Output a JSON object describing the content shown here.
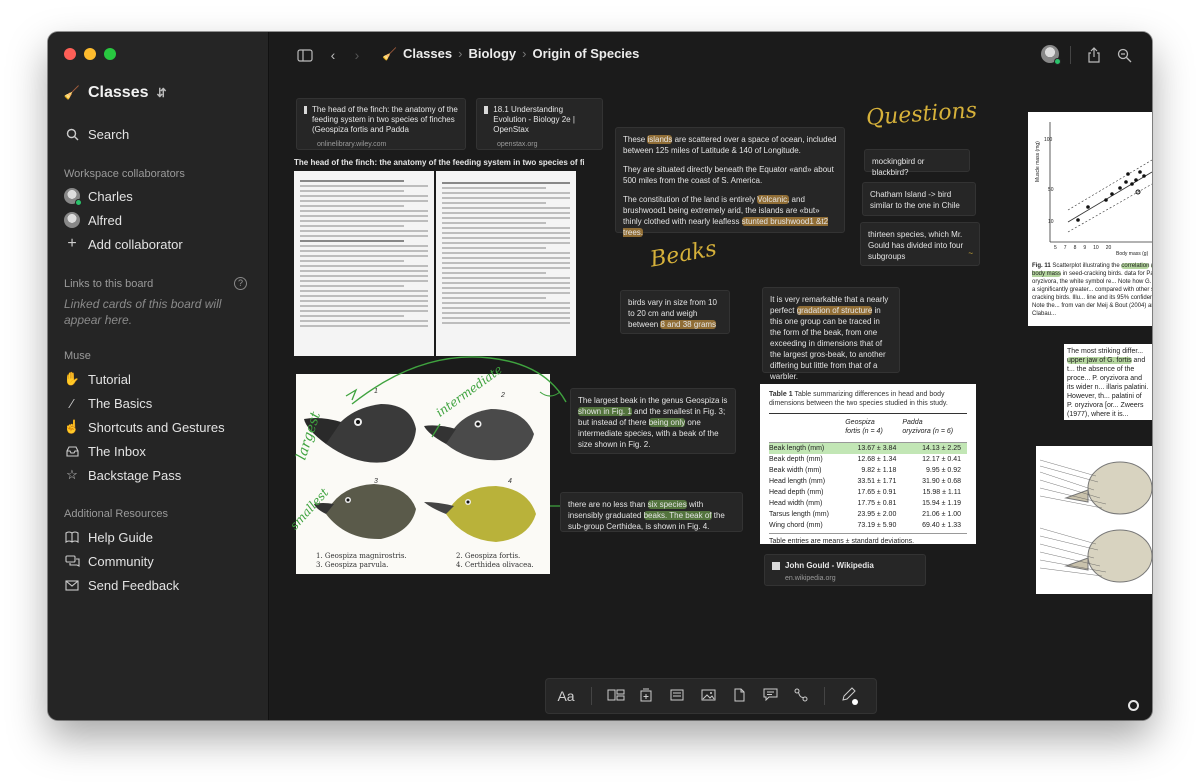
{
  "sidebar": {
    "board_title": "Classes",
    "search_label": "Search",
    "collaborators_header": "Workspace collaborators",
    "collaborators": [
      "Charles",
      "Alfred"
    ],
    "add_collaborator": "Add collaborator",
    "links_header": "Links to this board",
    "links_note": "Linked cards of this board will appear here.",
    "muse_header": "Muse",
    "muse_items": [
      "Tutorial",
      "The Basics",
      "Shortcuts and Gestures",
      "The Inbox",
      "Backstage Pass"
    ],
    "resources_header": "Additional Resources",
    "resource_items": [
      "Help Guide",
      "Community",
      "Send Feedback"
    ]
  },
  "breadcrumb": [
    "Classes",
    "Biology",
    "Origin of Species"
  ],
  "cards": {
    "link1_title": "The head of the finch: the anatomy of the feeding system in two species of finches (Geospiza fortis and Padda",
    "link1_url": "onlinelibrary.wiley.com",
    "link2_title": "18.1 Understanding Evolution - Biology 2e | OpenStax",
    "link2_url": "openstax.org",
    "pdf_title": "The head of the finch: the anatomy of the feeding system in two species of finches (Ge...",
    "islands_p1_a": "These ",
    "islands_p1_hl": "islands",
    "islands_p1_b": " are scattered over a space of ocean, included between 125 miles of Latitude & 140 of Longitude.",
    "islands_p2": "They are situated directly beneath the Equator «and» about 500 miles from the coast of S. America.",
    "islands_p3_a": "The constitution of the land is entirely ",
    "islands_p3_hl": "Volcanic,",
    "islands_p3_b": " and brushwood1 being extremely arid, the islands are «but» thinly clothed with nearly leafless ",
    "islands_p3_hl2": "stunted brushwood1 &t2 trees.",
    "questions_title": "Questions",
    "q1": "mockingbird or blackbird?",
    "q2": "Chatham Island -> bird similar to the one in Chile",
    "q3": "thirteen species, which Mr. Gould has divided into four subgroups",
    "beaks_title": "Beaks",
    "beaks_size_a": "birds vary in size from 10 to 20 cm and weigh between ",
    "beaks_size_hl": "8 and 38 grams",
    "gradation_a": "It is very remarkable that a nearly perfect ",
    "gradation_hl": "gradation of structure",
    "gradation_b": " in this one group can be traced in the form of the beak, from one exceeding in dimensions that of the largest gros-beak, to another differing but little from that of a warbler.",
    "largest_a": "The largest beak in the genus Geospiza is ",
    "largest_hl": "shown in Fig. 1",
    "largest_b": " and the smallest in Fig. 3; but instead of there ",
    "largest_hl2": "being only",
    "largest_c": " one intermediate species, with a beak of the size shown in Fig. 2.",
    "six_a": "there are no less than ",
    "six_hl": "six species",
    "six_b": " with insensibly graduated ",
    "six_hl2": "beaks. The beak of",
    "six_c": " the sub-group Certhidea, is shown in Fig. 4.",
    "gould_title": "John Gould - Wikipedia",
    "gould_url": "en.wikipedia.org",
    "fig11_caption_a": "Fig. 11",
    "fig11_caption_b": " Scatterplot illustrating the ",
    "fig11_caption_hl": "correlation",
    "fig11_caption_hl2": "mass and body mass",
    "fig11_caption_c": " in seed-cracking birds. data for Padda oryzivora, the white symbol re... Note how G. fortis has a significantly greater... compared with other seed-cracking birds. Illu... line and its 95% confidence limits. Note the... from van der Meij & Bout (2004) and Clabau...",
    "fig11_xlabel": "Body mass (g)",
    "fig11_ylabel": "Muscle mass (mg)",
    "fig11_xticks": [
      "5",
      "7",
      "8",
      "9",
      "10",
      "20"
    ],
    "fig11_yticks": [
      "100",
      "50",
      "10"
    ],
    "excerpt_a": "The most striking differ... ",
    "excerpt_hl": "upper jaw of G. fortis",
    "excerpt_b": " and t... the absence of the proce... P. oryzivora and its wider n... illaris palatini. However, th... palatini of P. oryzivora [or... Zweers (1977), where it is... probably results from a fusi..."
  },
  "annotations": {
    "largest": "largest",
    "intermediate": "intermediate",
    "smallest": "smallest"
  },
  "illustration_captions": [
    "1. Geospiza magnirostris.",
    "2. Geospiza fortis.",
    "3. Geospiza parvula.",
    "4. Certhidea olivacea."
  ],
  "illustration_numbers": [
    "1",
    "2",
    "3",
    "4"
  ],
  "table": {
    "caption_label": "Table 1",
    "caption": "Table summarizing differences in head and body dimensions between the two species studied in this study.",
    "col1": "Geospiza",
    "col1_n": "fortis (n = 4)",
    "col2": "Padda",
    "col2_n": "oryzivora (n = 6)",
    "rows": [
      [
        "Beak length (mm)",
        "13.67 ± 3.84",
        "14.13 ± 2.25"
      ],
      [
        "Beak depth (mm)",
        "12.68 ± 1.34",
        "12.17 ± 0.41"
      ],
      [
        "Beak width (mm)",
        "9.82 ± 1.18",
        "9.95 ± 0.92"
      ],
      [
        "Head length (mm)",
        "33.51 ± 1.71",
        "31.90 ± 0.68"
      ],
      [
        "Head depth (mm)",
        "17.65 ± 0.91",
        "15.98 ± 1.11"
      ],
      [
        "Head width (mm)",
        "17.75 ± 0.81",
        "15.94 ± 1.19"
      ],
      [
        "Tarsus length (mm)",
        "23.95 ± 2.00",
        "21.06 ± 1.00"
      ],
      [
        "Wing chord (mm)",
        "73.19 ± 5.90",
        "69.40 ± 1.33"
      ]
    ],
    "footnote": "Table entries are means ± standard deviations."
  },
  "toolbar": {
    "text_tool": "Aa"
  },
  "colors": {
    "accent_green": "#78b450",
    "accent_orange": "#be8c3c",
    "handwriting": "#d6b13a",
    "ink_green": "#3fa33f"
  }
}
